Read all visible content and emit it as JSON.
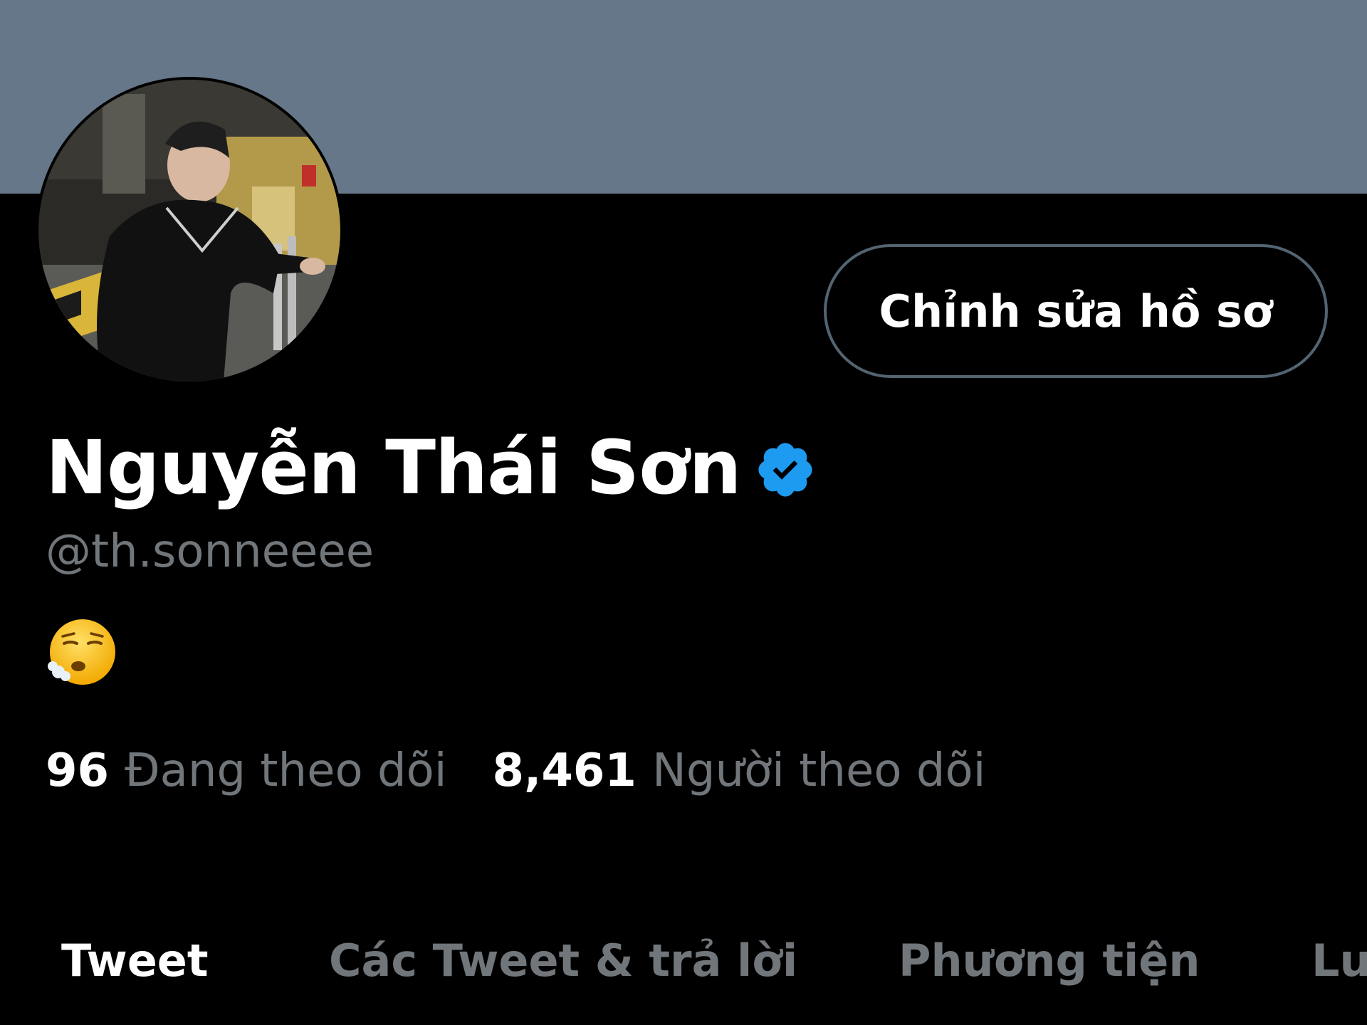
{
  "profile": {
    "display_name": "Nguyễn Thái Sơn",
    "handle": "@th.sonneeee",
    "bio": "😮‍💨",
    "verified_color": "#1d9bf0",
    "banner_color": "#66778a"
  },
  "actions": {
    "edit_profile_label": "Chỉnh sửa hồ sơ"
  },
  "stats": {
    "following_count": "96",
    "following_label": "Đang theo dõi",
    "followers_count": "8,461",
    "followers_label": "Người theo dõi"
  },
  "tabs": [
    {
      "label": "Tweet",
      "active": true
    },
    {
      "label": "Các Tweet & trả lời",
      "active": false
    },
    {
      "label": "Phương tiện",
      "active": false
    },
    {
      "label": "Lu",
      "active": false
    }
  ],
  "icons": {
    "verified": "verified-badge-icon",
    "bio_emoji": "face-exhaling-emoji"
  }
}
